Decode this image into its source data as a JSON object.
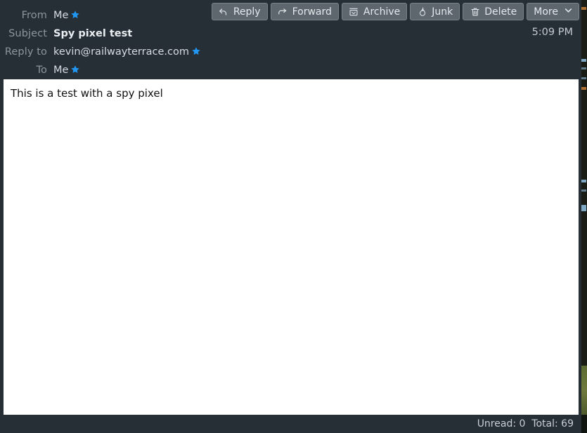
{
  "window": {
    "title": "Spy pixel test"
  },
  "toolbar": {
    "buttons": [
      {
        "label": "Reply",
        "icon": "reply-icon"
      },
      {
        "label": "Forward",
        "icon": "forward-icon"
      },
      {
        "label": "Archive",
        "icon": "archive-icon"
      },
      {
        "label": "Junk",
        "icon": "flame-icon"
      },
      {
        "label": "Delete",
        "icon": "trash-icon"
      },
      {
        "label": "More",
        "icon": "chevron-down-icon"
      }
    ],
    "more_chevron": "⌄"
  },
  "header": {
    "fields": [
      {
        "label": "From",
        "value": "Me",
        "starred": true,
        "bold": false
      },
      {
        "label": "Subject",
        "value": "Spy pixel test",
        "starred": false,
        "bold": true
      },
      {
        "label": "Reply to",
        "value": "kevin@railwayterrace.com",
        "starred": true,
        "bold": false
      },
      {
        "label": "To",
        "value": "Me",
        "starred": true,
        "bold": false
      }
    ],
    "date": "5:09 PM",
    "star_glyph": "★"
  },
  "message_body": {
    "text": "This is a test with a spy pixel"
  },
  "status_bar": {
    "text": "Unread: 0  Total: 69",
    "unread_label": "Unread:",
    "unread_count": "0",
    "total_label": "Total:",
    "total_count": "69"
  },
  "colors": {
    "chrome_bg": "#262f35",
    "toolbar_button_bg": "#5d676d",
    "toolbar_button_border": "#79838a",
    "body_bg": "#ffffff",
    "body_text": "#111111",
    "label_text": "#8c969c",
    "value_text": "#d6dde2",
    "star_blue": "#2196f3"
  }
}
